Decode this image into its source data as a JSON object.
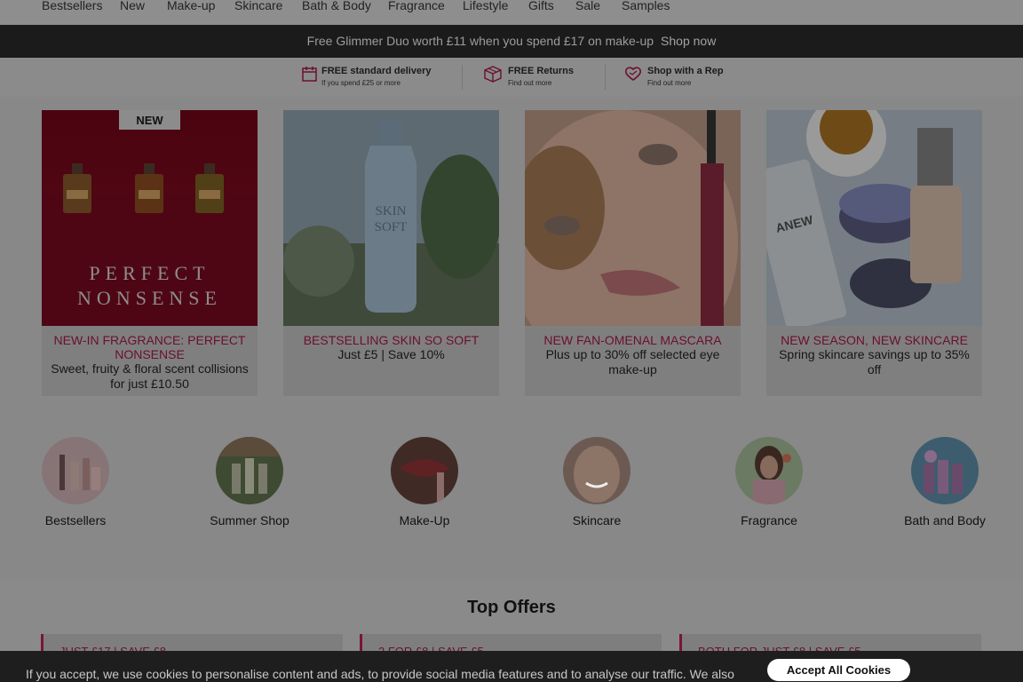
{
  "nav": {
    "items": [
      "Bestsellers",
      "New",
      "Make-up",
      "Skincare",
      "Bath & Body",
      "Fragrance",
      "Lifestyle",
      "Gifts",
      "Sale",
      "Samples"
    ]
  },
  "promo": {
    "text": "Free Glimmer Duo worth £11 when you spend £17 on make-up",
    "link": "Shop now"
  },
  "usp": [
    {
      "icon": "calendar-icon",
      "title": "FREE standard delivery",
      "sub": "If you spend £25 or more"
    },
    {
      "icon": "box-icon",
      "title": "FREE Returns",
      "sub": "Find out more"
    },
    {
      "icon": "heart-icon",
      "title": "Shop with a Rep",
      "sub": "Find out more"
    }
  ],
  "cards": [
    {
      "badge": "NEW",
      "overlay": "PERFECT\nNONSENSE",
      "title": "NEW-IN FRAGRANCE: PERFECT NONSENSE",
      "sub": "Sweet, fruity & floral scent collisions for just £10.50"
    },
    {
      "overlay": "SKIN\nSOFT",
      "title": "BESTSELLING SKIN SO SOFT",
      "sub": "Just £5 | Save 10%"
    },
    {
      "title": "NEW FAN-OMENAL MASCARA",
      "sub": "Plus up to 30% off selected eye make-up"
    },
    {
      "overlay": "ANEW",
      "title": "NEW SEASON, NEW SKINCARE",
      "sub": "Spring skincare savings up to 35% off"
    }
  ],
  "categories": [
    "Bestsellers",
    "Summer Shop",
    "Make-Up",
    "Skincare",
    "Fragrance",
    "Bath and Body"
  ],
  "offers": {
    "heading": "Top Offers",
    "items": [
      "JUST £17 | SAVE £8",
      "2 FOR £8 | SAVE £5",
      "BOTH FOR JUST £8 | SAVE £5"
    ]
  },
  "cookie": {
    "text": "If you accept, we use cookies to personalise content and ads, to provide social media features and to analyse our traffic. We also",
    "accept": "Accept All Cookies"
  },
  "colors": {
    "accent": "#6b0f2f",
    "overlay_dim": "#888888",
    "banner": "#1b1b1b"
  }
}
